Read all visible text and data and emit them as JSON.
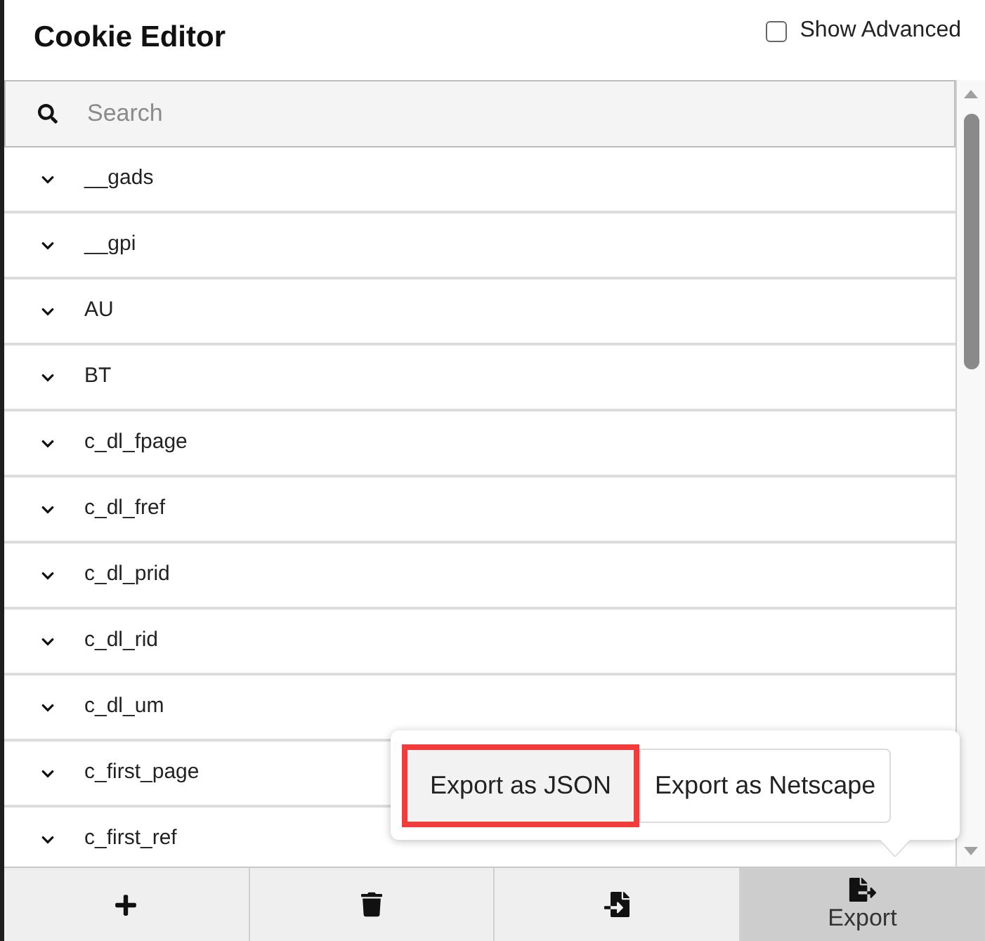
{
  "header": {
    "title": "Cookie Editor",
    "show_advanced": {
      "label": "Show Advanced",
      "checked": false
    }
  },
  "search": {
    "placeholder": "Search"
  },
  "cookies": [
    {
      "name": "__gads",
      "expanded": false
    },
    {
      "name": "__gpi",
      "expanded": false
    },
    {
      "name": "AU",
      "expanded": false
    },
    {
      "name": "BT",
      "expanded": false
    },
    {
      "name": "c_dl_fpage",
      "expanded": false
    },
    {
      "name": "c_dl_fref",
      "expanded": false
    },
    {
      "name": "c_dl_prid",
      "expanded": false
    },
    {
      "name": "c_dl_rid",
      "expanded": false
    },
    {
      "name": "c_dl_um",
      "expanded": false
    },
    {
      "name": "c_first_page",
      "expanded": false
    },
    {
      "name": "c_first_ref",
      "expanded": false
    }
  ],
  "export_menu": {
    "options": [
      {
        "label": "Export as JSON",
        "highlighted": true
      },
      {
        "label": "Export as Netscape",
        "highlighted": false
      }
    ]
  },
  "toolbar": [
    {
      "kind": "add",
      "selected": false
    },
    {
      "kind": "delete",
      "selected": false
    },
    {
      "kind": "import",
      "selected": false
    },
    {
      "kind": "export",
      "label": "Export",
      "selected": true
    }
  ]
}
